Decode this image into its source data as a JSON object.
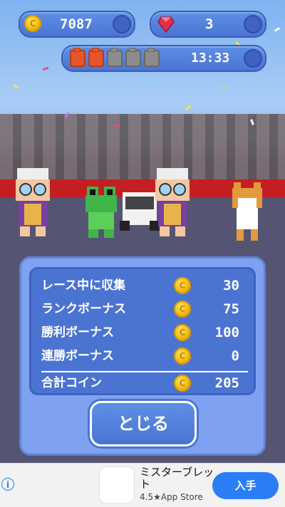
{
  "hud": {
    "coins": "7087",
    "gems": "3",
    "fuel_timer": "13:33",
    "fuel_full": 2,
    "fuel_total": 5,
    "coin_color": "#f2b90c",
    "gem_color": "#e0304a"
  },
  "results": {
    "rows": [
      {
        "label": "レース中に収集",
        "value": "30"
      },
      {
        "label": "ランクボーナス",
        "value": "75"
      },
      {
        "label": "勝利ボーナス",
        "value": "100"
      },
      {
        "label": "連勝ボーナス",
        "value": "0"
      }
    ],
    "total_label": "合計コイン",
    "total_value": "205",
    "close_label": "とじる"
  },
  "ad": {
    "info_icon": "i",
    "title": "ミスターブレッ\nト",
    "subtitle": "4.5★App Store",
    "get_label": "入手"
  },
  "colors": {
    "panel": "#7ea2ef",
    "panel_inner": "#4b74d2",
    "red_wall": "#c41e23",
    "ad_button": "#2a7ef5"
  }
}
